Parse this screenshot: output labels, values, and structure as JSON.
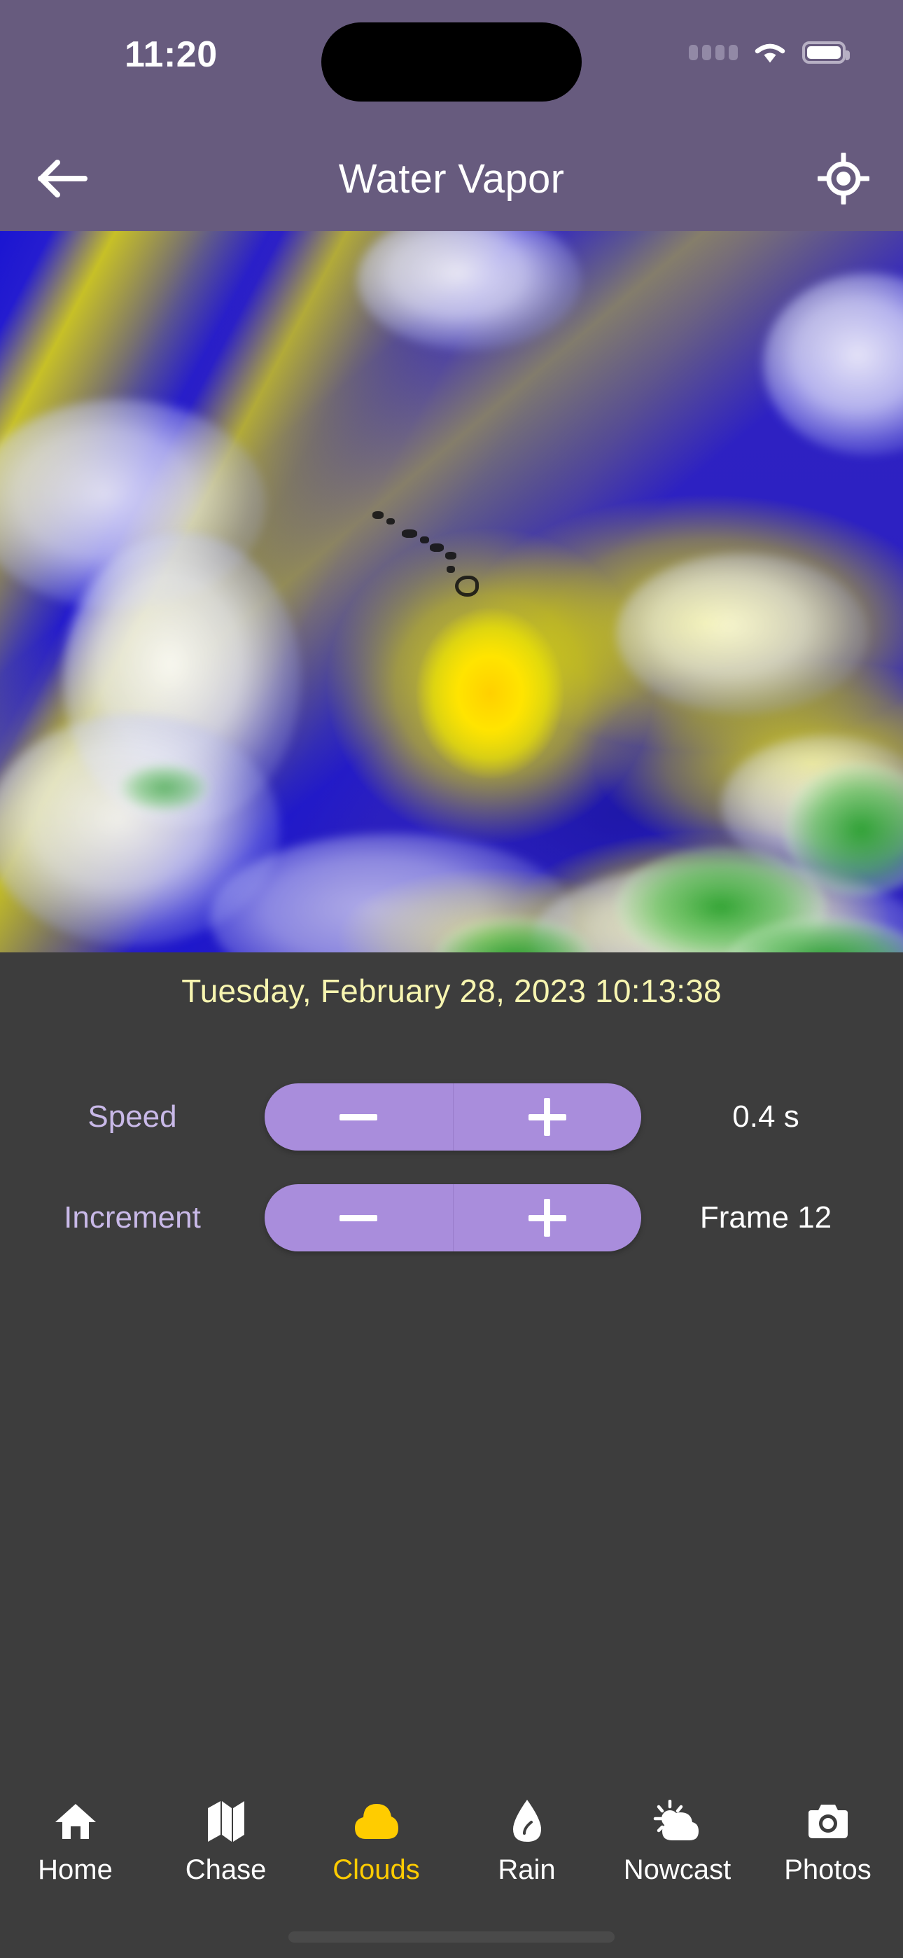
{
  "status_bar": {
    "time": "11:20",
    "signal_icon": "signal-dots-icon",
    "wifi_icon": "wifi-icon",
    "battery_icon": "battery-icon"
  },
  "app_bar": {
    "title": "Water Vapor",
    "back_icon": "back-arrow-icon",
    "gps_icon": "gps-target-icon"
  },
  "satellite": {
    "product_name": "Water Vapor",
    "timestamp": "Tuesday, February 28, 2023 10:13:38",
    "timestamp_color": "#f7f5b0"
  },
  "controls": [
    {
      "label": "Speed",
      "value": "0.4 s",
      "decrease_icon": "minus-icon",
      "increase_icon": "plus-icon"
    },
    {
      "label": "Increment",
      "value": "Frame 12",
      "decrease_icon": "minus-icon",
      "increase_icon": "plus-icon"
    }
  ],
  "tab_bar": {
    "active_color": "#ffcc00",
    "inactive_color": "#ffffff",
    "items": [
      {
        "label": "Home",
        "icon": "home-icon",
        "active": false
      },
      {
        "label": "Chase",
        "icon": "map-icon",
        "active": false
      },
      {
        "label": "Clouds",
        "icon": "cloud-icon",
        "active": true
      },
      {
        "label": "Rain",
        "icon": "droplet-icon",
        "active": false
      },
      {
        "label": "Nowcast",
        "icon": "sun-cloud-icon",
        "active": false
      },
      {
        "label": "Photos",
        "icon": "camera-icon",
        "active": false
      }
    ]
  },
  "theme": {
    "header_purple": "#675b7e",
    "body_gray": "#3d3d3d",
    "stepper_purple": "#a98ddc",
    "label_purple": "#c9b9e8"
  }
}
